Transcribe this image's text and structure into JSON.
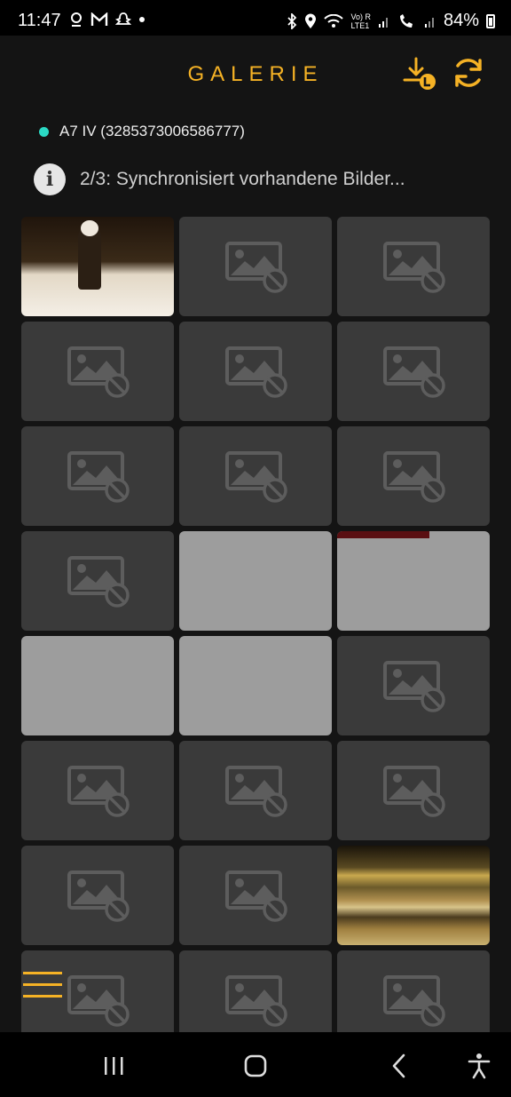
{
  "status_bar": {
    "time": "11:47",
    "left_icons": [
      "location-pin-icon",
      "gmail-icon",
      "snapchat-icon",
      "dot-icon"
    ],
    "right_icons": [
      "bluetooth-icon",
      "location-icon",
      "wifi-icon",
      "volte-icon",
      "signal-icon",
      "wifi-call-icon",
      "signal-2-icon"
    ],
    "volte_label": "Vo) R\nLTE1",
    "battery": "84%"
  },
  "header": {
    "title": "GALERIE",
    "download_icon": "download-icon",
    "sync_icon": "sync-icon",
    "accent_color": "#f5b225"
  },
  "camera": {
    "label": "A7 IV (3285373006586777)",
    "status_color": "#2bd9c4"
  },
  "sync_status": {
    "text": "2/3: Synchronisiert vorhandene Bilder..."
  },
  "gallery": {
    "tiles": [
      {
        "kind": "photo"
      },
      {
        "kind": "placeholder"
      },
      {
        "kind": "placeholder"
      },
      {
        "kind": "placeholder"
      },
      {
        "kind": "placeholder"
      },
      {
        "kind": "placeholder"
      },
      {
        "kind": "placeholder"
      },
      {
        "kind": "placeholder"
      },
      {
        "kind": "placeholder"
      },
      {
        "kind": "placeholder"
      },
      {
        "kind": "gray"
      },
      {
        "kind": "gray-topred"
      },
      {
        "kind": "gray"
      },
      {
        "kind": "gray"
      },
      {
        "kind": "placeholder"
      },
      {
        "kind": "placeholder"
      },
      {
        "kind": "placeholder"
      },
      {
        "kind": "placeholder"
      },
      {
        "kind": "placeholder"
      },
      {
        "kind": "placeholder"
      },
      {
        "kind": "glitch"
      },
      {
        "kind": "placeholder"
      },
      {
        "kind": "placeholder"
      },
      {
        "kind": "placeholder"
      }
    ]
  },
  "menu_icon": "hamburger-menu-icon",
  "nav_bar": {
    "recents": "recents-icon",
    "home": "home-icon",
    "back": "back-icon",
    "accessibility": "accessibility-icon"
  }
}
